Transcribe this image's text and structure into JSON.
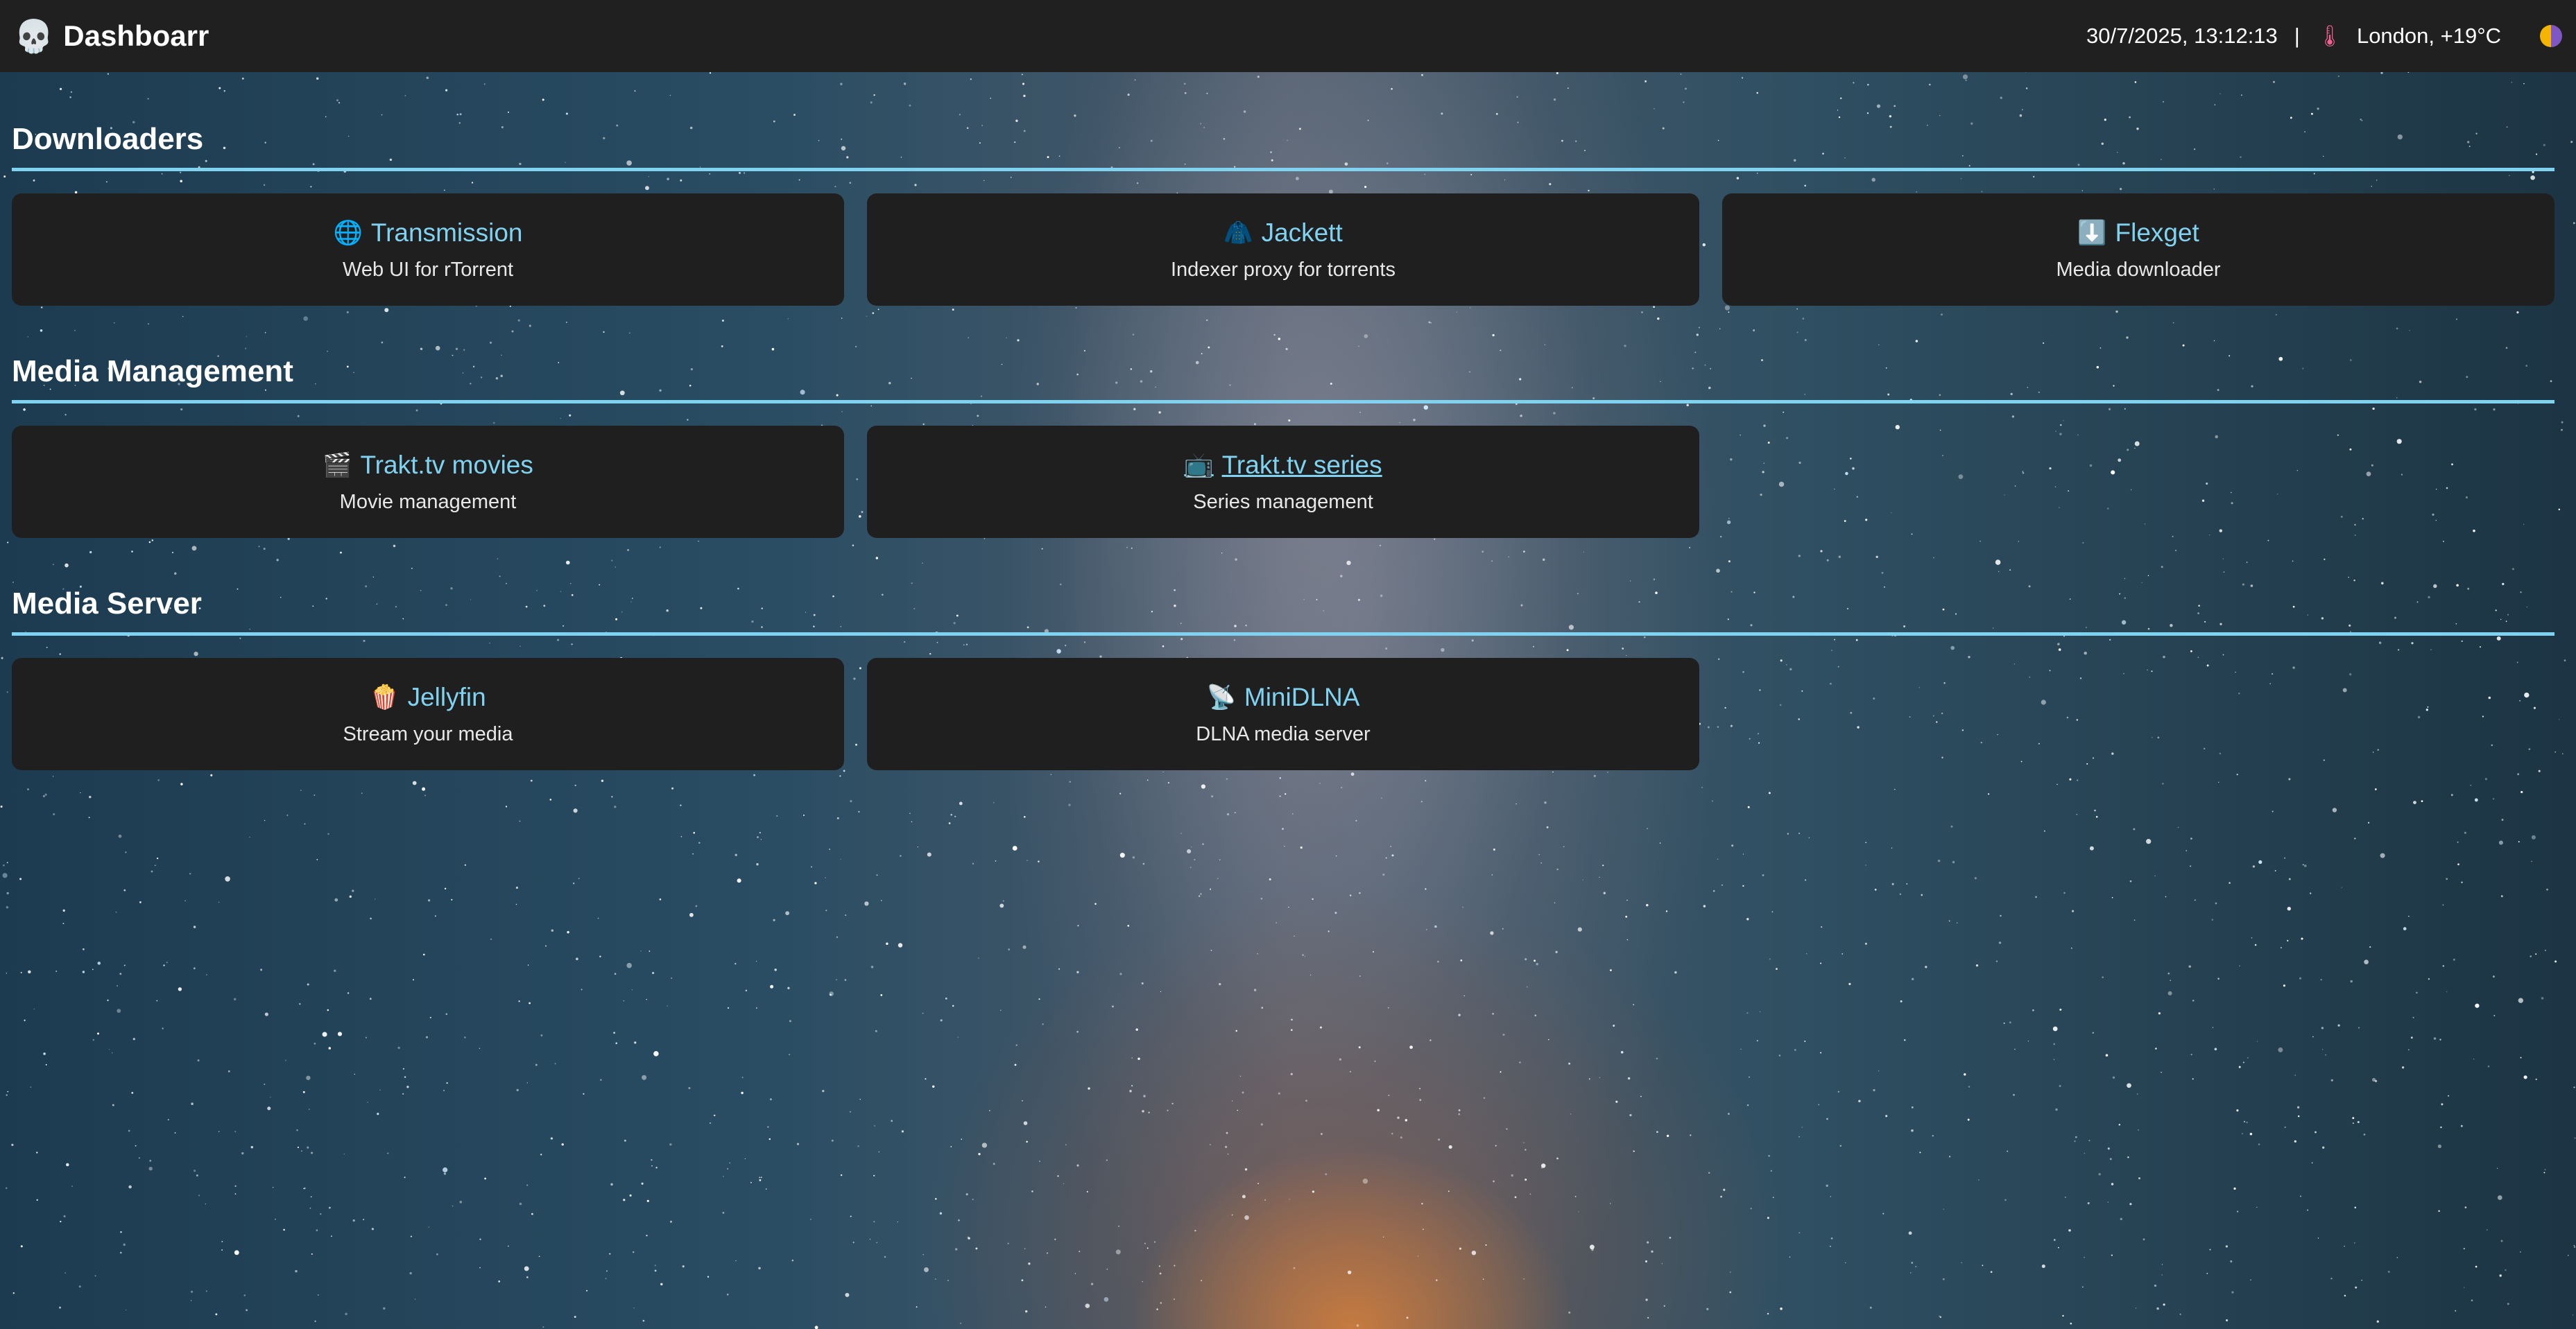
{
  "header": {
    "logo_icon": "💀",
    "title": "Dashboarr",
    "datetime": "30/7/2025, 13:12:13",
    "separator": "|",
    "weather_icon": "🌡",
    "weather": "London, +19°C",
    "theme_toggle_icon": "half-moon-icon"
  },
  "sections": [
    {
      "title": "Downloaders",
      "cards": [
        {
          "icon": "🌐",
          "name": "Transmission",
          "desc": "Web UI for rTorrent"
        },
        {
          "icon": "🧥",
          "name": "Jackett",
          "desc": "Indexer proxy for torrents"
        },
        {
          "icon": "⬇️",
          "name": "Flexget",
          "desc": "Media downloader"
        }
      ]
    },
    {
      "title": "Media Management",
      "cards": [
        {
          "icon": "🎬",
          "name": "Trakt.tv movies",
          "desc": "Movie management"
        },
        {
          "icon": "📺",
          "name": "Trakt.tv series",
          "desc": "Series management"
        }
      ]
    },
    {
      "title": "Media Server",
      "cards": [
        {
          "icon": "🍿",
          "name": "Jellyfin",
          "desc": "Stream your media"
        },
        {
          "icon": "📡",
          "name": "MiniDLNA",
          "desc": "DLNA media server"
        }
      ]
    }
  ],
  "colors": {
    "accent": "#7fd3f0",
    "card_bg": "#1f1f1f",
    "topbar_bg": "#202020"
  }
}
